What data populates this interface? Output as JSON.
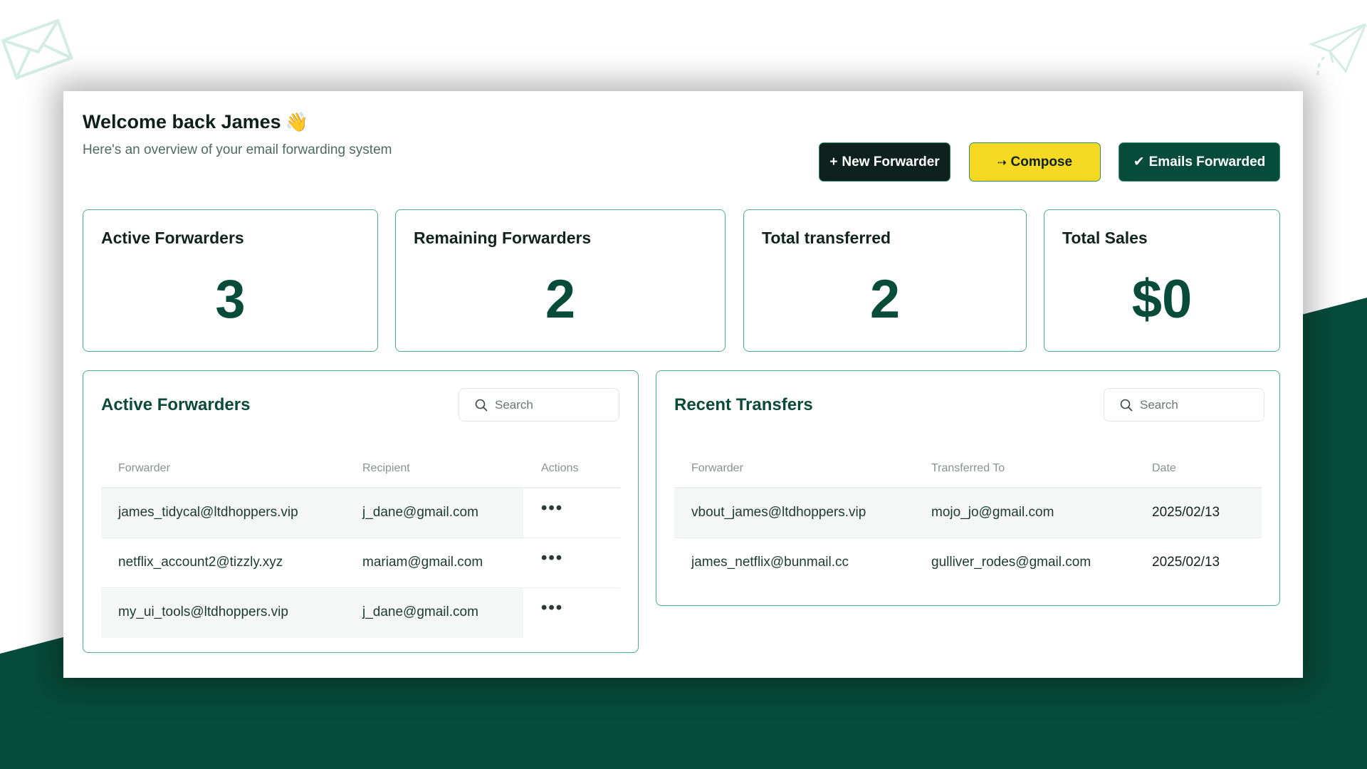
{
  "header": {
    "title": "Welcome back James",
    "wave_emoji": "👋",
    "subtitle": "Here's an overview of your email forwarding system"
  },
  "actions": {
    "new_forwarder": {
      "icon": "+",
      "label": "New Forwarder"
    },
    "compose": {
      "icon": "⇢",
      "label": "Compose"
    },
    "emails_forwarded": {
      "icon": "✔",
      "label": "Emails Forwarded"
    }
  },
  "stats": [
    {
      "label": "Active Forwarders",
      "value": "3"
    },
    {
      "label": "Remaining Forwarders",
      "value": "2"
    },
    {
      "label": "Total transferred",
      "value": "2"
    },
    {
      "label": "Total Sales",
      "value": "$0"
    }
  ],
  "active_forwarders": {
    "title": "Active Forwarders",
    "search_placeholder": "Search",
    "columns": [
      "Forwarder",
      "Recipient",
      "Actions"
    ],
    "rows": [
      {
        "forwarder": "james_tidycal@ltdhoppers.vip",
        "recipient": "j_dane@gmail.com",
        "actions": "•••"
      },
      {
        "forwarder": "netflix_account2@tizzly.xyz",
        "recipient": "mariam@gmail.com",
        "actions": "•••"
      },
      {
        "forwarder": "my_ui_tools@ltdhoppers.vip",
        "recipient": "j_dane@gmail.com",
        "actions": "•••"
      }
    ]
  },
  "recent_transfers": {
    "title": "Recent Transfers",
    "search_placeholder": "Search",
    "columns": [
      "Forwarder",
      "Transferred To",
      "Date"
    ],
    "rows": [
      {
        "forwarder": "vbout_james@ltdhoppers.vip",
        "transferred_to": "mojo_jo@gmail.com",
        "date": "2025/02/13"
      },
      {
        "forwarder": "james_netflix@bunmail.cc",
        "transferred_to": "gulliver_rodes@gmail.com",
        "date": "2025/02/13"
      }
    ]
  },
  "colors": {
    "brand_green": "#074c3a",
    "accent_yellow": "#f5d923",
    "dark": "#0e211c",
    "card_border": "#4cae8c"
  }
}
